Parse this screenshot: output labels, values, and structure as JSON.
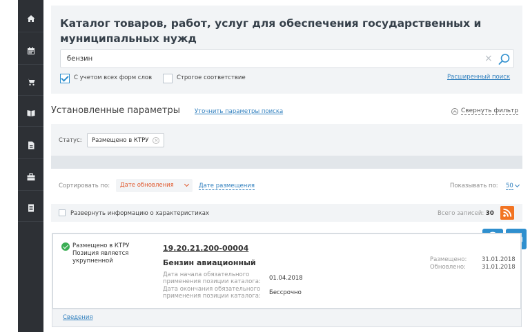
{
  "sidebar": {
    "items": [
      {
        "icon": "home-icon"
      },
      {
        "icon": "calendar-icon"
      },
      {
        "icon": "cart-icon"
      },
      {
        "icon": "book-icon"
      },
      {
        "icon": "document-icon"
      },
      {
        "icon": "briefcase-icon"
      },
      {
        "icon": "list-icon"
      }
    ]
  },
  "search": {
    "title": "Каталог товаров, работ, услуг для обеспечения государственных и муниципальных нужд",
    "query": "бензин",
    "clear": "×",
    "opt_all_forms": "С учетом всех форм слов",
    "opt_strict": "Строгое соответствие",
    "advanced": "Расширенный поиск"
  },
  "params": {
    "title": "Установленные параметры",
    "refine": "Уточнить параметры поиска",
    "collapse": "Свернуть фильтр",
    "status_label": "Статус:",
    "status_value": "Размещено в КТРУ",
    "chip_x": "×"
  },
  "sorting": {
    "label": "Сортировать по:",
    "selected": "Дате обновления",
    "alt": "Дате размещения",
    "show_label": "Показывать по:",
    "show_value": "50"
  },
  "list": {
    "expand": "Развернуть информацию о характеристиках",
    "total_label": "Всего записей:",
    "total": "30"
  },
  "result": {
    "status_1": "Размещено в КТРУ",
    "status_2": "Позиция является",
    "status_3": "укрупненной",
    "code": "19.20.21.200-00004",
    "name": "Бензин авиационный",
    "start_label_1": "Дата начала обязательного",
    "start_label_2": "применения позиции каталога:",
    "start_value": "01.04.2018",
    "end_label_1": "Дата окончания обязательного",
    "end_label_2": "применения позиции каталога:",
    "end_value": "Бессрочно",
    "placed_label": "Размещено:",
    "placed_value": "31.01.2018",
    "updated_label": "Обновлено:",
    "updated_value": "31.01.2018",
    "details": "Сведения"
  },
  "colors": {
    "sidebar": "#2d3035",
    "panel": "#f2f4f6",
    "link": "#2f7fbe",
    "accent_orange": "#e0572b",
    "rss": "#f27423",
    "action_blue": "#2f8fce",
    "ok_green": "#3bae54"
  }
}
